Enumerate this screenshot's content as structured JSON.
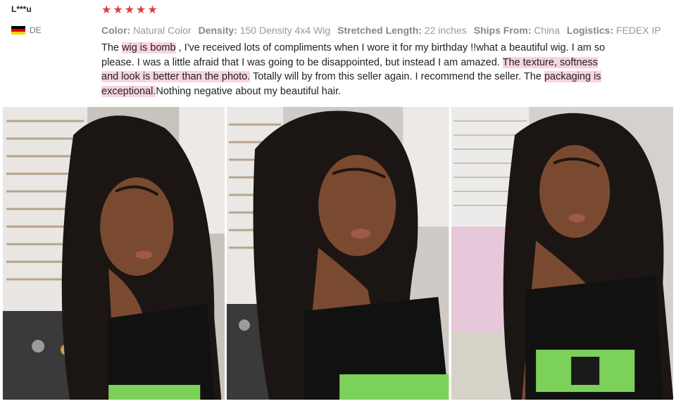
{
  "reviewer": {
    "name": "L***u",
    "country_code": "DE"
  },
  "rating": {
    "stars": 5,
    "max": 5,
    "star_glyph": "★",
    "color": "#e4393c"
  },
  "attributes": [
    {
      "label": "Color:",
      "value": "Natural Color"
    },
    {
      "label": "Density:",
      "value": "150 Density 4x4 Wig"
    },
    {
      "label": "Stretched Length:",
      "value": "22 inches"
    },
    {
      "label": "Ships From:",
      "value": "China"
    },
    {
      "label": "Logistics:",
      "value": "FEDEX IP"
    }
  ],
  "review": {
    "seg1": "The ",
    "hl1": "wig is bomb",
    "seg2": " , I've received lots of compliments when I wore it for my birthday !!what a beautiful wig. I am so please. I was a little afraid that I was going to be disappointed, but instead I am amazed. ",
    "hl2": "The texture, softness and look is better than the photo.",
    "seg3": " Totally will by from this seller again. I recommend the seller. The ",
    "hl3": "packaging is exceptional.",
    "seg4": "Nothing negative about my beautiful hair.",
    "highlight_color": "#f9d3dd"
  },
  "photos": [
    {
      "name": "review-photo-1"
    },
    {
      "name": "review-photo-2"
    },
    {
      "name": "review-photo-3"
    }
  ]
}
